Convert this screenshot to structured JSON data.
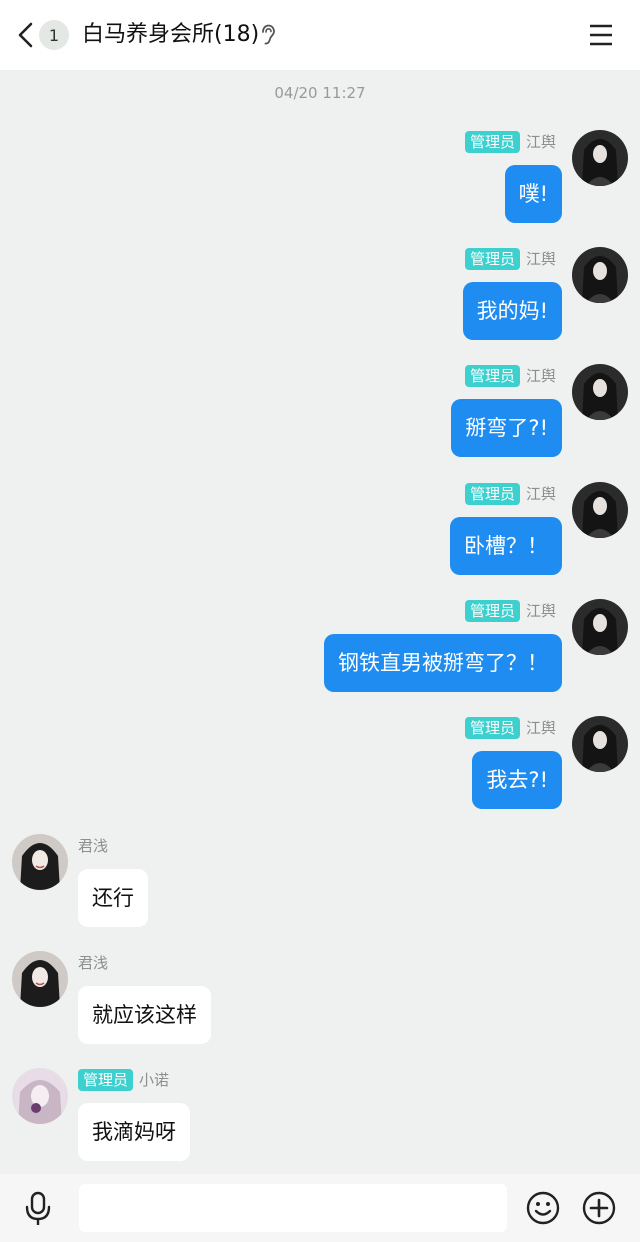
{
  "header": {
    "unread_count": "1",
    "title": "白马养身会所(18)",
    "back_icon": "chevron-left-icon",
    "ear_icon": "ear-icon",
    "menu_icon": "menu-icon"
  },
  "timestamp": "04/20 11:27",
  "colors": {
    "outgoing_bubble": "#1e8cf0",
    "incoming_bubble": "#ffffff",
    "role_badge": "#3ecfcf",
    "background": "#eef1ef"
  },
  "messages": [
    {
      "side": "right",
      "role": "管理员",
      "name": "江舆",
      "text": "噗!"
    },
    {
      "side": "right",
      "role": "管理员",
      "name": "江舆",
      "text": "我的妈!"
    },
    {
      "side": "right",
      "role": "管理员",
      "name": "江舆",
      "text": "掰弯了?!"
    },
    {
      "side": "right",
      "role": "管理员",
      "name": "江舆",
      "text": "卧槽？！"
    },
    {
      "side": "right",
      "role": "管理员",
      "name": "江舆",
      "text": "钢铁直男被掰弯了？！"
    },
    {
      "side": "right",
      "role": "管理员",
      "name": "江舆",
      "text": "我去?!"
    },
    {
      "side": "left",
      "role": "",
      "name": "君浅",
      "text": "还行"
    },
    {
      "side": "left",
      "role": "",
      "name": "君浅",
      "text": "就应该这样"
    },
    {
      "side": "left",
      "role": "管理员",
      "name": "小诺",
      "text": "我滴妈呀"
    }
  ],
  "input_bar": {
    "placeholder": "",
    "mic_icon": "microphone-icon",
    "emoji_icon": "emoji-icon",
    "plus_icon": "plus-circle-icon"
  }
}
